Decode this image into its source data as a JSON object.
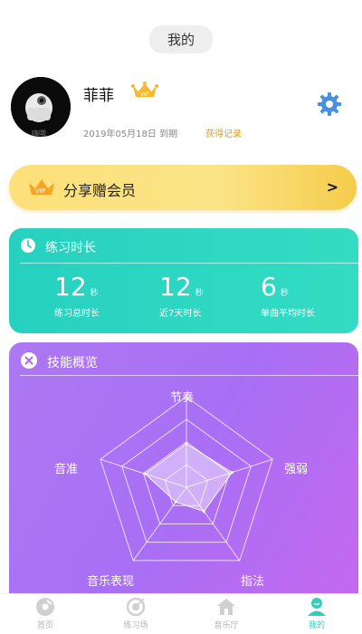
{
  "header": {
    "title": "我的"
  },
  "profile": {
    "avatar_caption": "嗨哦",
    "username": "菲菲",
    "vip_badge": "VIP",
    "expire_text": "2019年05月18日 到期",
    "records_link": "获得记录",
    "settings_icon": "gear-icon"
  },
  "vip_banner": {
    "badge": "VIP",
    "label": "分享赠会员",
    "arrow": ">"
  },
  "practice": {
    "title": "练习时长",
    "stats": [
      {
        "value": "12",
        "unit": "秒",
        "label": "练习总时长"
      },
      {
        "value": "12",
        "unit": "秒",
        "label": "近7天时长"
      },
      {
        "value": "6",
        "unit": "秒",
        "label": "单曲平均时长"
      }
    ]
  },
  "skills": {
    "title": "技能概览",
    "axes": [
      "节奏",
      "强弱",
      "指法",
      "音乐表现",
      "音准"
    ],
    "values": [
      0.48,
      0.53,
      0.33,
      0.2,
      0.48
    ]
  },
  "tabbar": {
    "tabs": [
      {
        "label": "首页",
        "icon": "home-disc-icon",
        "active": false
      },
      {
        "label": "练习场",
        "icon": "target-icon",
        "active": false
      },
      {
        "label": "音乐厅",
        "icon": "house-icon",
        "active": false
      },
      {
        "label": "我的",
        "icon": "user-icon",
        "active": true
      }
    ]
  },
  "colors": {
    "accent": "#2fcfc0",
    "practice_card": "#2ed6c2",
    "skill_card": "#ad74f3",
    "vip_banner": "#fbe07a",
    "gold": "#e3a21b",
    "settings_blue": "#4a90e2"
  }
}
